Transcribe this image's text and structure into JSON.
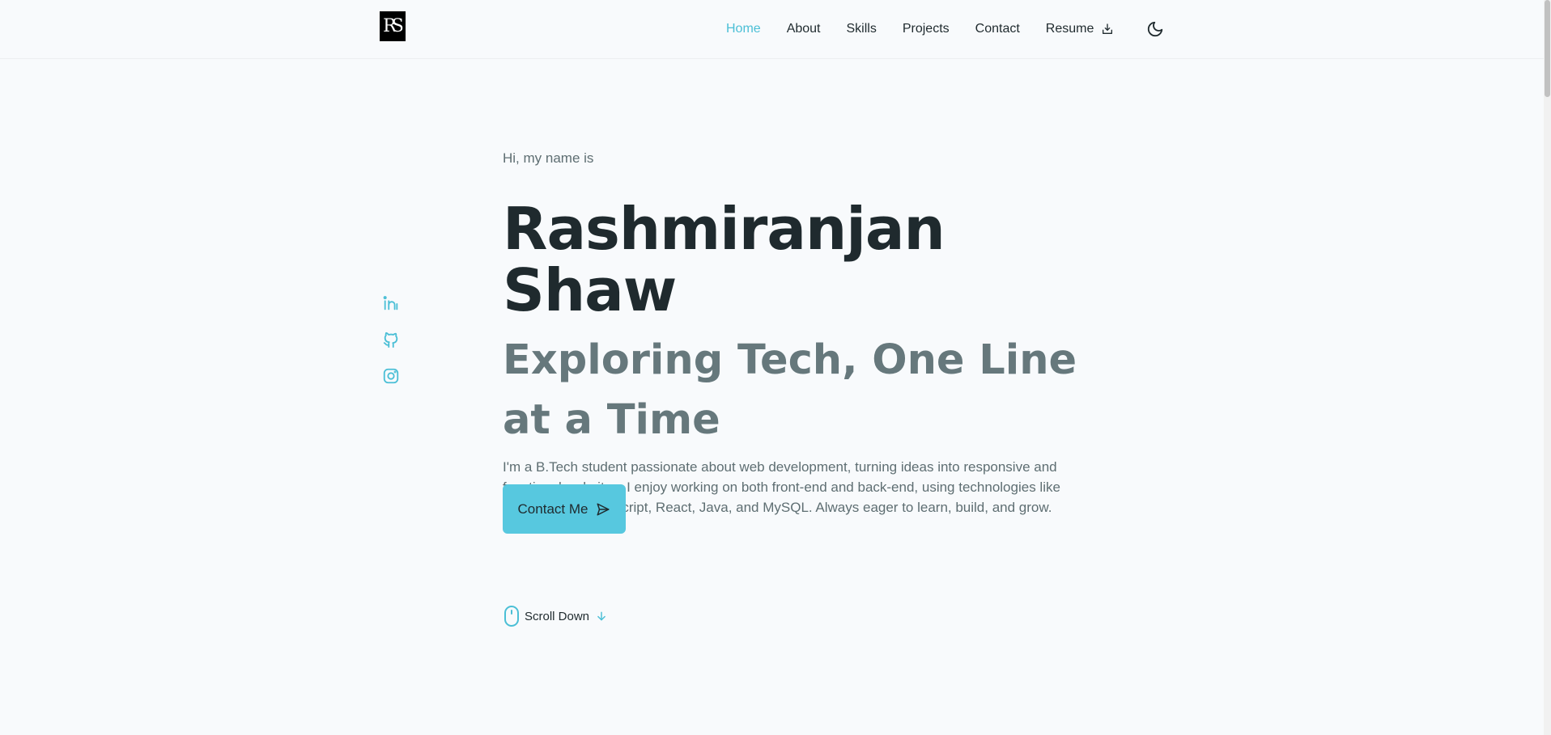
{
  "logo": {
    "text": "RS"
  },
  "nav": {
    "items": [
      {
        "label": "Home",
        "active": true
      },
      {
        "label": "About"
      },
      {
        "label": "Skills"
      },
      {
        "label": "Projects"
      },
      {
        "label": "Contact"
      },
      {
        "label": "Resume",
        "icon": "download-icon"
      }
    ],
    "theme_icon": "moon-icon"
  },
  "social": [
    "linkedin-icon",
    "github-icon",
    "instagram-icon"
  ],
  "hero": {
    "greeting": "Hi, my name is",
    "name": "Rashmiranjan Shaw",
    "tagline": "Exploring Tech, One Line at a Time",
    "description": "I'm a B.Tech student passionate about web development, turning ideas into responsive and functional websites. I enjoy working on both front-end and back-end, using technologies like HTML, CSS, JavaScript, React, Java, and MySQL. Always eager to learn, build, and grow.",
    "cta_label": "Contact Me",
    "scroll_label": "Scroll Down"
  },
  "colors": {
    "accent": "#4bbfd6",
    "button": "#57c8df",
    "text": "#1f2a2e",
    "muted": "#66787c",
    "background": "#f8fafc"
  }
}
